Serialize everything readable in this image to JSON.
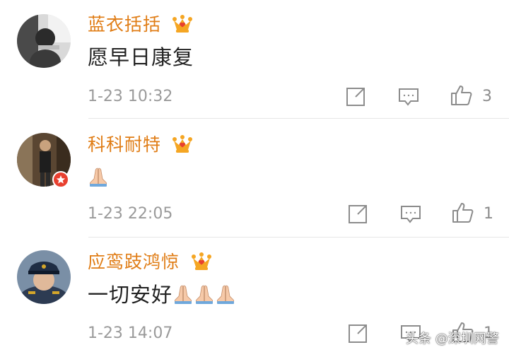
{
  "comments": [
    {
      "username": "蓝衣括括",
      "text": "愿早日康复",
      "pray_count": 0,
      "time": "1-23 10:32",
      "like_count": "3",
      "avatar_icon": "avatar-grayscale-child-icon",
      "crown_icon": "vip-crown-icon"
    },
    {
      "username": "科科耐特",
      "text": "",
      "pray_count": 1,
      "time": "1-23 22:05",
      "like_count": "1",
      "avatar_icon": "avatar-person-dark-icon",
      "crown_icon": "vip-crown-icon",
      "badge_icon": "red-star-badge-icon"
    },
    {
      "username": "应鸾跂鸿惊",
      "text": "一切安好",
      "pray_count": 3,
      "time": "1-23 14:07",
      "like_count": "1",
      "avatar_icon": "avatar-officer-cap-icon",
      "crown_icon": "vip-crown-icon"
    }
  ],
  "watermark": "头条 @深圳网警",
  "colors": {
    "username": "#e07d16",
    "text": "#222222",
    "time": "#9a9a9a",
    "icon": "#8c8c8c",
    "divider": "#e6e6e6",
    "crown": "#f5a623"
  }
}
